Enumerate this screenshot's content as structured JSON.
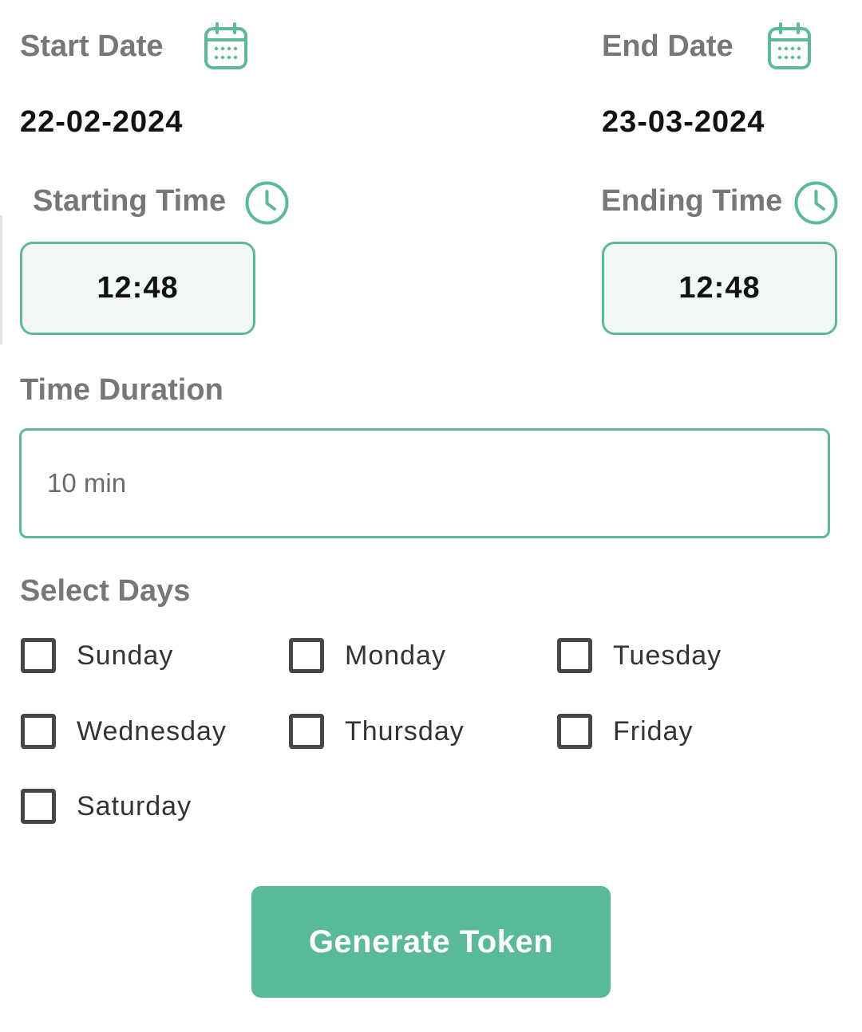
{
  "start_date": {
    "label": "Start Date",
    "value": "22-02-2024",
    "icon": "calendar-icon"
  },
  "end_date": {
    "label": "End Date",
    "value": "23-03-2024",
    "icon": "calendar-icon"
  },
  "starting_time": {
    "label": "Starting Time",
    "value": "12:48",
    "icon": "clock-icon"
  },
  "ending_time": {
    "label": "Ending Time",
    "value": "12:48",
    "icon": "clock-icon"
  },
  "duration": {
    "label": "Time Duration",
    "value": "10 min"
  },
  "days": {
    "label": "Select Days",
    "items": [
      {
        "label": "Sunday",
        "checked": false
      },
      {
        "label": "Monday",
        "checked": false
      },
      {
        "label": "Tuesday",
        "checked": false
      },
      {
        "label": "Wednesday",
        "checked": false
      },
      {
        "label": "Thursday",
        "checked": false
      },
      {
        "label": "Friday",
        "checked": false
      },
      {
        "label": "Saturday",
        "checked": false
      }
    ]
  },
  "generate_button": {
    "label": "Generate Token"
  },
  "colors": {
    "accent": "#5db99c",
    "button": "#58b99b",
    "label_gray": "#777777",
    "checkbox_border": "#45454a"
  }
}
